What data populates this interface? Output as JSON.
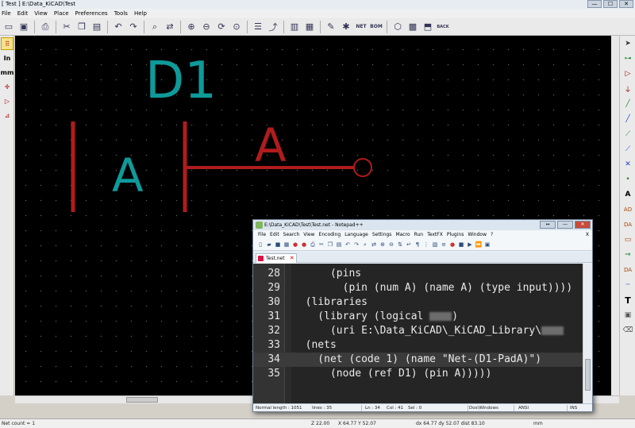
{
  "kicad": {
    "title": "[ Test ] E:\\Data_KiCAD\\Test",
    "window_buttons": [
      "—",
      "☐",
      "✕"
    ],
    "menu": [
      "File",
      "Edit",
      "View",
      "Place",
      "Preferences",
      "Tools",
      "Help"
    ],
    "toolbar_icons": [
      "new-sheet-icon",
      "save-icon",
      "print-icon",
      "cut-icon",
      "copy-icon",
      "paste-icon",
      "undo-icon",
      "redo-icon",
      "find-icon",
      "replace-icon",
      "zoom-in-icon",
      "zoom-out-icon",
      "zoom-redraw-icon",
      "zoom-fit-icon",
      "hierarchy-icon",
      "leave-sheet-icon",
      "library-editor-icon",
      "library-browser-icon",
      "annotate-icon",
      "erc-icon",
      "netlist-icon",
      "bom-icon",
      "cvpcb-icon",
      "pcbnew-icon",
      "import-footprints-icon",
      "back-annotate-icon"
    ],
    "toolbar_labels": {
      "netlist": "NET",
      "bom": "BOM",
      "back_annotate": "BACK"
    },
    "left_tools": [
      {
        "name": "grid-toggle-icon",
        "glyph": "⠿",
        "active": true
      },
      {
        "name": "units-inch-icon",
        "glyph": "In",
        "active": false
      },
      {
        "name": "units-mm-icon",
        "glyph": "mm",
        "active": false
      },
      {
        "name": "cursor-shape-icon",
        "glyph": "✛",
        "active": false
      },
      {
        "name": "hidden-pins-icon",
        "glyph": "▷",
        "active": false
      },
      {
        "name": "bus-wire-45-icon",
        "glyph": "⊿",
        "active": false
      }
    ],
    "right_tools": [
      "select-arrow-icon",
      "hierarchy-nav-icon",
      "add-component-icon",
      "add-power-icon",
      "add-wire-icon",
      "add-bus-icon",
      "wire-bus-entry-icon",
      "bus-bus-entry-icon",
      "no-connect-icon",
      "add-junction-icon",
      "net-label-icon",
      "global-label-icon",
      "hier-label-icon",
      "add-sheet-icon",
      "import-sheet-pin-icon",
      "sheet-pin-icon",
      "add-graphic-line-icon",
      "add-text-icon",
      "add-image-icon",
      "delete-icon"
    ],
    "right_tool_labels": {
      "net_label": "A",
      "global_label": "AD",
      "hier_label": "DA",
      "text": "T"
    },
    "schematic": {
      "reference": "D1",
      "pin_name": "A",
      "pin_number": "A"
    },
    "statusbar": {
      "net_count": "Net count = 1",
      "zoom": "Z 22.00",
      "xy": "X 64.77  Y 52.07",
      "dxdy": "dx 64.77  dy 52.07  dist 83.10",
      "units": "mm"
    },
    "colors": {
      "canvas": "#000000",
      "symbol": "#b01c1c",
      "reference": "#0f9a9a"
    }
  },
  "notepad": {
    "title": "E:\\Data_KiCAD\\Test\\Test.net - Notepad++",
    "window_buttons": [
      "↔",
      "—",
      "✕"
    ],
    "menu": [
      "File",
      "Edit",
      "Search",
      "View",
      "Encoding",
      "Language",
      "Settings",
      "Macro",
      "Run",
      "TextFX",
      "Plugins",
      "Window",
      "?"
    ],
    "menu_close": "X",
    "tab": "Test.net",
    "lines": [
      {
        "num": "28",
        "code": "      (pins",
        "current": false,
        "blurred": false
      },
      {
        "num": "29",
        "code": "        (pin (num A) (name A) (type input))))",
        "current": false,
        "blurred": false
      },
      {
        "num": "30",
        "code": "  (libraries",
        "current": false,
        "blurred": false
      },
      {
        "num": "31",
        "code": "    (library (logical ",
        "current": false,
        "blurred": true,
        "tail": ")"
      },
      {
        "num": "32",
        "code": "      (uri E:\\Data_KiCAD\\_KiCAD_Library\\",
        "current": false,
        "blurred": true,
        "tail": ""
      },
      {
        "num": "33",
        "code": "  (nets",
        "current": false,
        "blurred": false
      },
      {
        "num": "34",
        "code": "    (net (code 1) (name \"Net-(D1-PadA)\")",
        "current": true,
        "blurred": false
      },
      {
        "num": "35",
        "code": "      (node (ref D1) (pin A)))))",
        "current": false,
        "blurred": false
      }
    ],
    "status": {
      "length": "Normal length : 1051",
      "lines": "lines : 35",
      "ln": "Ln : 34",
      "col": "Col : 41",
      "sel": "Sel : 0",
      "eol": "Dos\\Windows",
      "encoding": "ANSI",
      "mode": "INS"
    }
  }
}
